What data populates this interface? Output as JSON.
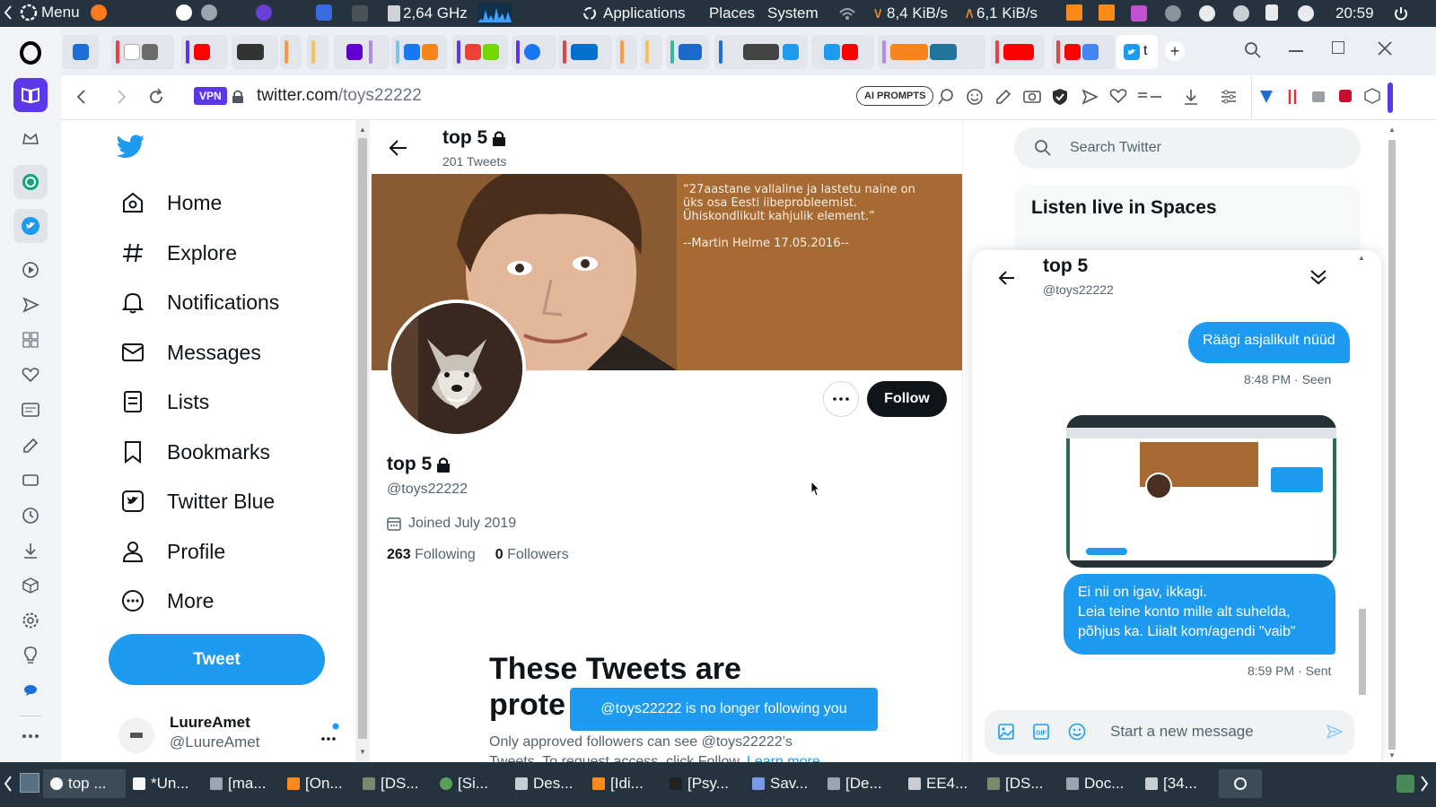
{
  "system_panel": {
    "menu_label": "Menu",
    "cpu_freq": "2,64 GHz",
    "apps": [
      {
        "label": "Applications"
      },
      {
        "label": "Places"
      },
      {
        "label": "System"
      }
    ],
    "net_down": "8,4 KiB/s",
    "net_up": "6,1 KiB/s",
    "clock": "20:59"
  },
  "browser": {
    "vpn_badge": "VPN",
    "url_host": "twitter.com",
    "url_path": "/toys22222",
    "ai_prompts_label": "AI PROMPTS",
    "active_tab_label": "t"
  },
  "twitter_nav": {
    "items": [
      {
        "label": "Home",
        "icon": "home-icon"
      },
      {
        "label": "Explore",
        "icon": "hashtag-icon"
      },
      {
        "label": "Notifications",
        "icon": "bell-icon"
      },
      {
        "label": "Messages",
        "icon": "envelope-icon"
      },
      {
        "label": "Lists",
        "icon": "list-icon"
      },
      {
        "label": "Bookmarks",
        "icon": "bookmark-icon"
      },
      {
        "label": "Twitter Blue",
        "icon": "twitter-blue-icon"
      },
      {
        "label": "Profile",
        "icon": "person-icon"
      },
      {
        "label": "More",
        "icon": "more-circle-icon"
      }
    ],
    "tweet_button": "Tweet",
    "account": {
      "name": "LuureAmet",
      "handle": "@LuureAmet"
    }
  },
  "profile": {
    "header_name": "top 5",
    "tweet_count": "201 Tweets",
    "banner_quote": "“27aastane vallaline ja lastetu naine on üks osa Eesti iibeprobleemist. Ühiskondlikult kahjulik element.”",
    "banner_author": "--Martin Helme 17.05.2016--",
    "name": "top 5",
    "handle": "@toys22222",
    "joined": "Joined July 2019",
    "following_count": "263",
    "following_label": "Following",
    "followers_count": "0",
    "followers_label": "Followers",
    "follow_button": "Follow",
    "protected_title_line1": "These Tweets are",
    "protected_title_line2": "prote",
    "protected_desc_line1": "Only approved followers can see @toys22222’s",
    "protected_desc_line2": "Tweets. To request access, click Follow.",
    "learn_more": "Learn more",
    "toast": "@toys22222 is no longer following you"
  },
  "right_column": {
    "search_placeholder": "Search Twitter",
    "spaces_title": "Listen live in Spaces"
  },
  "dm": {
    "name": "top 5",
    "handle": "@toys22222",
    "messages": [
      {
        "text": "Räägi asjalikult nüüd",
        "meta": "8:48 PM · Seen"
      },
      {
        "text": "Ei nii on igav,  ikkagi.\n Leia teine konto mille alt suhelda,\npõhjus ka.  Liialt kom/agendi \"vaib\"",
        "meta": "8:59 PM · Sent"
      }
    ],
    "composer_placeholder": "Start a new message"
  },
  "taskbar": {
    "items": [
      {
        "label": "top ..."
      },
      {
        "label": "*Un..."
      },
      {
        "label": "[ma..."
      },
      {
        "label": "[On..."
      },
      {
        "label": "[DS..."
      },
      {
        "label": "[Si..."
      },
      {
        "label": "Des..."
      },
      {
        "label": "[Idi..."
      },
      {
        "label": "[Psy..."
      },
      {
        "label": "Sav..."
      },
      {
        "label": "[De..."
      },
      {
        "label": "EE4..."
      },
      {
        "label": "[DS..."
      },
      {
        "label": "Doc..."
      },
      {
        "label": "[34..."
      }
    ]
  },
  "colors": {
    "twitter_blue": "#1d9bf0",
    "panel_dark": "#24333d",
    "banner_brown": "#a86a33"
  }
}
